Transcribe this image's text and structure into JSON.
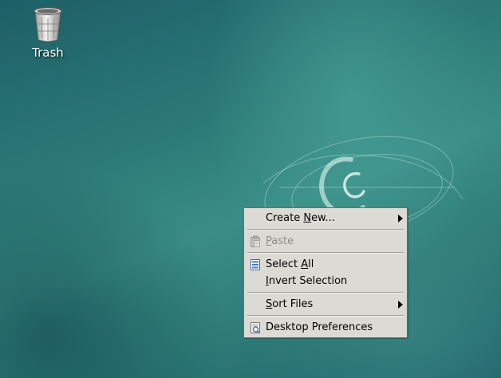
{
  "desktop": {
    "icons": [
      {
        "label": "Trash",
        "icon": "trash-icon"
      }
    ]
  },
  "context_menu": {
    "items": [
      {
        "pre": "Create ",
        "accel": "N",
        "post": "ew...",
        "icon": "",
        "submenu": true,
        "disabled": false
      },
      {
        "pre": "",
        "accel": "P",
        "post": "aste",
        "icon": "paste-icon",
        "submenu": false,
        "disabled": true
      },
      {
        "pre": "Select ",
        "accel": "A",
        "post": "ll",
        "icon": "select-all-icon",
        "submenu": false,
        "disabled": false
      },
      {
        "pre": "",
        "accel": "I",
        "post": "nvert Selection",
        "icon": "",
        "submenu": false,
        "disabled": false
      },
      {
        "pre": "",
        "accel": "S",
        "post": "ort Files",
        "icon": "",
        "submenu": true,
        "disabled": false
      },
      {
        "pre": "Desktop Preferences",
        "accel": "",
        "post": "",
        "icon": "preferences-icon",
        "submenu": false,
        "disabled": false
      }
    ]
  },
  "colors": {
    "menu_background": "#dcdad5",
    "disabled_text": "#8f8d88",
    "desktop_teal": "#2c7a78"
  }
}
